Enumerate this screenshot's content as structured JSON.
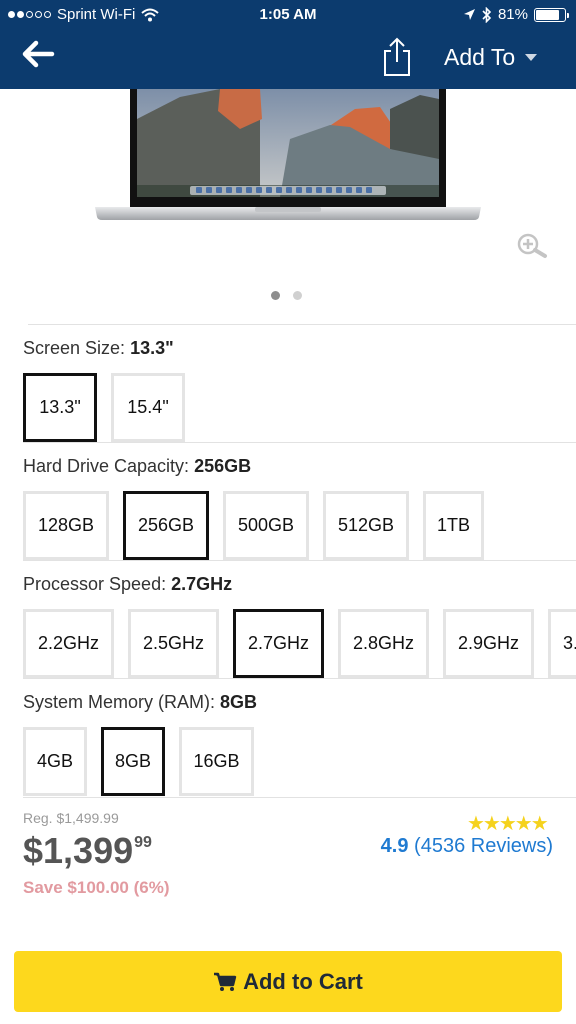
{
  "status_bar": {
    "carrier": "Sprint Wi-Fi",
    "time": "1:05 AM",
    "battery": "81%"
  },
  "header": {
    "add_to_label": "Add To",
    "background_color": "#0c3b6e"
  },
  "carousel": {
    "page_count": 2,
    "active_page": 1
  },
  "options": {
    "screen_size": {
      "label": "Screen Size:",
      "selected": "13.3\"",
      "choices": [
        "13.3\"",
        "15.4\""
      ]
    },
    "hard_drive": {
      "label": "Hard Drive Capacity:",
      "selected": "256GB",
      "choices": [
        "128GB",
        "256GB",
        "500GB",
        "512GB",
        "1TB"
      ]
    },
    "processor": {
      "label": "Processor Speed:",
      "selected": "2.7GHz",
      "choices": [
        "2.2GHz",
        "2.5GHz",
        "2.7GHz",
        "2.8GHz",
        "2.9GHz",
        "3."
      ]
    },
    "memory": {
      "label": "System Memory (RAM):",
      "selected": "8GB",
      "choices": [
        "4GB",
        "8GB",
        "16GB"
      ]
    }
  },
  "pricing": {
    "regular": "Reg. $1,499.99",
    "price_main": "$1,399",
    "price_cents": "99",
    "savings": "Save $100.00 (6%)",
    "stars": "★★★★★",
    "rating_value": "4.9",
    "reviews": "(4536 Reviews)"
  },
  "cart": {
    "label": "Add to Cart",
    "button_color": "#fdd81d"
  }
}
